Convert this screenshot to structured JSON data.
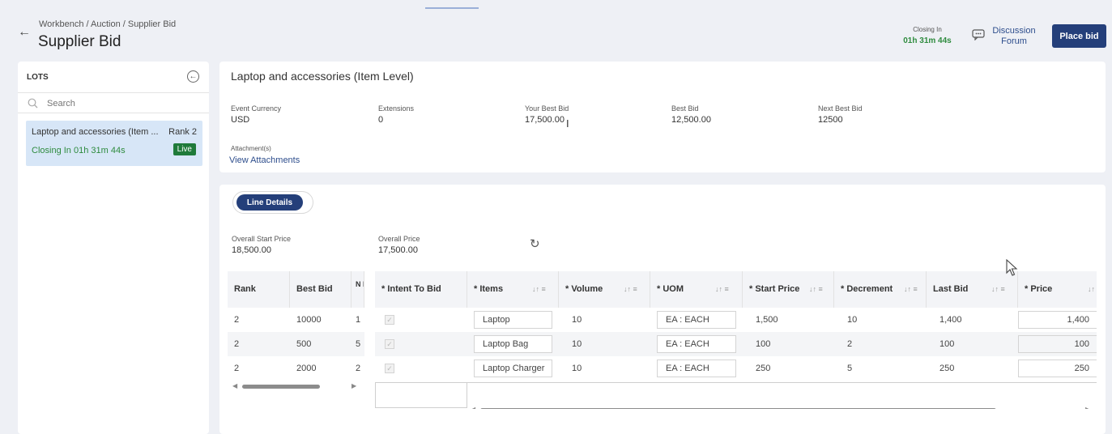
{
  "header": {
    "breadcrumb": "Workbench / Auction / Supplier Bid",
    "title": "Supplier Bid",
    "closing_label": "Closing In",
    "closing_value": "01h 31m 44s",
    "forum_label_1": "Discussion",
    "forum_label_2": "Forum",
    "place_bid": "Place bid"
  },
  "lots": {
    "heading": "LOTS",
    "search_placeholder": "Search",
    "items": [
      {
        "name": "Laptop and accessories (Item ...",
        "rank": "Rank 2",
        "closing": "Closing In 01h 31m 44s",
        "status": "Live"
      }
    ]
  },
  "lot_detail": {
    "title": "Laptop and accessories (Item Level)",
    "fields": [
      {
        "label": "Event Currency",
        "value": "USD"
      },
      {
        "label": "Extensions",
        "value": "0"
      },
      {
        "label": "Your Best Bid",
        "value": "17,500.00"
      },
      {
        "label": "Best Bid",
        "value": "12,500.00"
      },
      {
        "label": "Next Best Bid",
        "value": "12500"
      }
    ],
    "attachments_label": "Attachment(s)",
    "attachments_link": "View Attachments"
  },
  "line_details": {
    "tab_label": "Line Details",
    "overall_start_label": "Overall Start Price",
    "overall_start_value": "18,500.00",
    "overall_price_label": "Overall Price",
    "overall_price_value": "17,500.00",
    "left_columns": [
      "Rank",
      "Best Bid",
      "N B"
    ],
    "right_columns": [
      "* Intent To Bid",
      "* Items",
      "* Volume",
      "* UOM",
      "* Start Price",
      "* Decrement",
      "Last Bid",
      "* Price"
    ],
    "rows": [
      {
        "rank": "2",
        "best_bid": "10000",
        "next": "1",
        "item": "Laptop",
        "volume": "10",
        "uom": "EA : EACH",
        "start_price": "1,500",
        "decrement": "10",
        "last_bid": "1,400",
        "price": "1,400"
      },
      {
        "rank": "2",
        "best_bid": "500",
        "next": "5",
        "item": "Laptop Bag",
        "volume": "10",
        "uom": "EA : EACH",
        "start_price": "100",
        "decrement": "2",
        "last_bid": "100",
        "price": "100"
      },
      {
        "rank": "2",
        "best_bid": "2000",
        "next": "2",
        "item": "Laptop Charger",
        "volume": "10",
        "uom": "EA : EACH",
        "start_price": "250",
        "decrement": "5",
        "last_bid": "250",
        "price": "250"
      }
    ]
  },
  "icons": {
    "back": "arrow-left-icon",
    "forum": "chat-icon",
    "collapse": "collapse-left-icon",
    "search": "search-icon",
    "refresh": "refresh-icon",
    "sort": "sort-icon",
    "check": "checkbox-icon"
  },
  "colors": {
    "primary": "#243f7a",
    "live": "#1f7a3a",
    "closing": "#2e8b3e",
    "selected_lot": "#d7e6f7"
  }
}
